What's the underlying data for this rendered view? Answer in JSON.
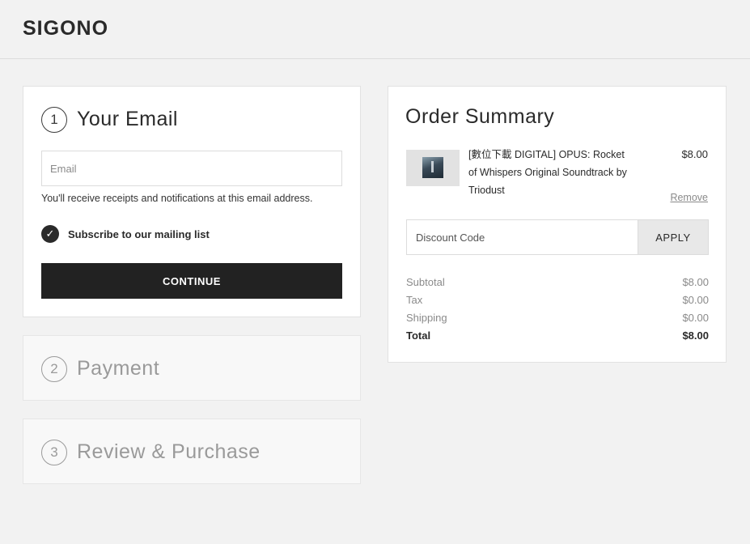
{
  "header": {
    "brand": "SIGONO"
  },
  "steps": [
    {
      "number": "1",
      "title": "Your Email"
    },
    {
      "number": "2",
      "title": "Payment"
    },
    {
      "number": "3",
      "title": "Review & Purchase"
    }
  ],
  "email_step": {
    "email_value": "",
    "email_placeholder": "Email",
    "hint": "You'll receive receipts and notifications at this email address.",
    "subscribe_checked": true,
    "subscribe_check_glyph": "✓",
    "subscribe_label": "Subscribe to our mailing list",
    "continue_label": "CONTINUE"
  },
  "order_summary": {
    "title": "Order Summary",
    "item": {
      "thumbnail_icon": "album-cover-image",
      "name": "[數位下載 DIGITAL] OPUS: Rocket of Whispers Original Soundtrack by Triodust",
      "price": "$8.00",
      "remove_label": "Remove"
    },
    "discount": {
      "value": "",
      "placeholder": "Discount Code",
      "apply_label": "APPLY"
    },
    "totals": [
      {
        "label": "Subtotal",
        "value": "$8.00"
      },
      {
        "label": "Tax",
        "value": "$0.00"
      },
      {
        "label": "Shipping",
        "value": "$0.00"
      },
      {
        "label": "Total",
        "value": "$8.00"
      }
    ]
  },
  "colors": {
    "background": "#f2f2f2",
    "card": "#ffffff",
    "primary_button": "#222222",
    "muted_text": "#9a9a9a"
  }
}
